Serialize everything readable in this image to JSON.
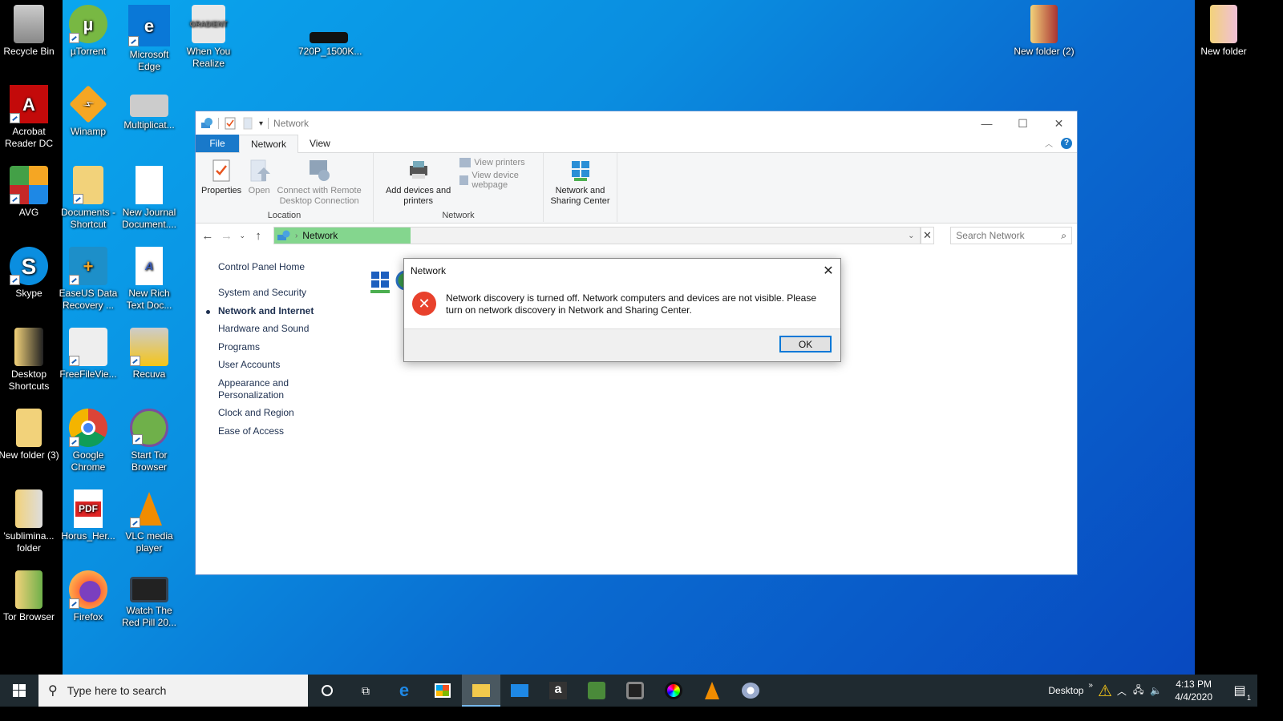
{
  "desktop": {
    "icons": [
      {
        "label": "Recycle Bin"
      },
      {
        "label": "µTorrent"
      },
      {
        "label": "Microsoft Edge"
      },
      {
        "label": "When You Realize"
      },
      {
        "label": "720P_1500K..."
      },
      {
        "label": "New folder (2)"
      },
      {
        "label": "New folder"
      },
      {
        "label": "Acrobat Reader DC"
      },
      {
        "label": "Winamp"
      },
      {
        "label": "Multiplicat..."
      },
      {
        "label": "AVG"
      },
      {
        "label": "Documents - Shortcut"
      },
      {
        "label": "New Journal Document...."
      },
      {
        "label": "Skype"
      },
      {
        "label": "EaseUS Data Recovery ..."
      },
      {
        "label": "New Rich Text Doc..."
      },
      {
        "label": "Desktop Shortcuts"
      },
      {
        "label": "FreeFileVie..."
      },
      {
        "label": "Recuva"
      },
      {
        "label": "New folder (3)"
      },
      {
        "label": "Google Chrome"
      },
      {
        "label": "Start Tor Browser"
      },
      {
        "label": "'sublimina... folder"
      },
      {
        "label": "Horus_Her..."
      },
      {
        "label": "VLC media player"
      },
      {
        "label": "Tor Browser"
      },
      {
        "label": "Firefox"
      },
      {
        "label": "Watch The Red Pill 20..."
      }
    ]
  },
  "explorer": {
    "title": "Network",
    "tabs": {
      "file": "File",
      "network": "Network",
      "view": "View"
    },
    "ribbon": {
      "location_group": "Location",
      "network_group": "Network",
      "properties": "Properties",
      "open": "Open",
      "connect_rdc": "Connect with Remote Desktop Connection",
      "add_devices": "Add devices and printers",
      "view_printers": "View printers",
      "view_device_webpage": "View device webpage",
      "network_sharing": "Network and Sharing Center"
    },
    "address": {
      "path": "Network"
    },
    "search": {
      "placeholder": "Search Network"
    },
    "sidebar": {
      "home": "Control Panel Home",
      "items": [
        {
          "label": "System and Security"
        },
        {
          "label": "Network and Internet",
          "active": true
        },
        {
          "label": "Hardware and Sound"
        },
        {
          "label": "Programs"
        },
        {
          "label": "User Accounts"
        },
        {
          "label": "Appearance and Personalization"
        },
        {
          "label": "Clock and Region"
        },
        {
          "label": "Ease of Access"
        }
      ]
    }
  },
  "dialog": {
    "title": "Network",
    "message": "Network discovery is turned off. Network computers and devices are not visible. Please turn on network discovery in Network and Sharing Center.",
    "ok": "OK"
  },
  "taskbar": {
    "search_placeholder": "Type here to search",
    "desktop_label": "Desktop",
    "time": "4:13 PM",
    "date": "4/4/2020",
    "notification_count": "1"
  }
}
